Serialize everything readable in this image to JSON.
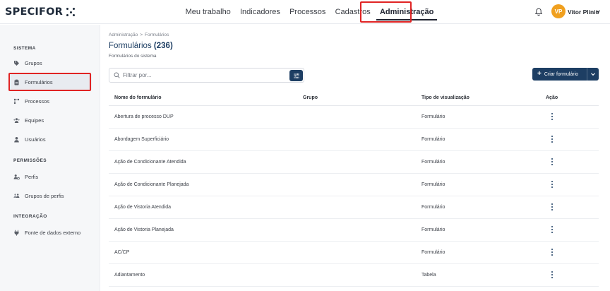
{
  "app": {
    "logo_text": "SPECIFOR"
  },
  "nav": {
    "items": [
      {
        "label": "Meu trabalho"
      },
      {
        "label": "Indicadores"
      },
      {
        "label": "Processos"
      },
      {
        "label": "Cadastros"
      },
      {
        "label": "Administração",
        "active": true
      }
    ]
  },
  "user": {
    "initials": "VP",
    "name": "Vitor Plinio",
    "avatar_color": "#f0a01f"
  },
  "sidebar": {
    "sections": [
      {
        "title": "SISTEMA"
      },
      {
        "title": "PERMISSÕES"
      },
      {
        "title": "INTEGRAÇÃO"
      }
    ],
    "items": [
      {
        "label": "Grupos",
        "icon": "tag-icon"
      },
      {
        "label": "Formulários",
        "icon": "clipboard-icon",
        "active": true
      },
      {
        "label": "Processos",
        "icon": "process-flow-icon"
      },
      {
        "label": "Equipes",
        "icon": "team-icon"
      },
      {
        "label": "Usuários",
        "icon": "user-icon"
      },
      {
        "label": "Perfis",
        "icon": "profile-settings-icon"
      },
      {
        "label": "Grupos de perfis",
        "icon": "profile-groups-icon"
      },
      {
        "label": "Fonte de dados externo",
        "icon": "plug-icon"
      }
    ]
  },
  "breadcrumb": {
    "parent": "Administração",
    "separator": ">",
    "current": "Formulários"
  },
  "page": {
    "title": "Formulários",
    "count": "(236)",
    "subtitle": "Formulários do sistema"
  },
  "search": {
    "placeholder": "Filtrar por...",
    "value": ""
  },
  "create_button": {
    "label": "Criar formulário"
  },
  "table": {
    "columns": [
      "Nome do formulário",
      "Grupo",
      "Tipo de visualização",
      "Ação"
    ],
    "rows": [
      {
        "name": "Abertura de processo DUP",
        "group": "",
        "type": "Formulário"
      },
      {
        "name": "Abordagem Superficiário",
        "group": "",
        "type": "Formulário"
      },
      {
        "name": "Ação de Condicionante Atendida",
        "group": "",
        "type": "Formulário"
      },
      {
        "name": "Ação de Condicionante Planejada",
        "group": "",
        "type": "Formulário"
      },
      {
        "name": "Ação de Vistoria Atendida",
        "group": "",
        "type": "Formulário"
      },
      {
        "name": "Ação de Vistoria Planejada",
        "group": "",
        "type": "Formulário"
      },
      {
        "name": "AC/CP",
        "group": "",
        "type": "Formulário"
      },
      {
        "name": "Adiantamento",
        "group": "",
        "type": "Tabela"
      }
    ]
  },
  "colors": {
    "primary": "#1d3e63",
    "highlight": "#e02424",
    "sidebar_bg": "#f6f7f9"
  }
}
